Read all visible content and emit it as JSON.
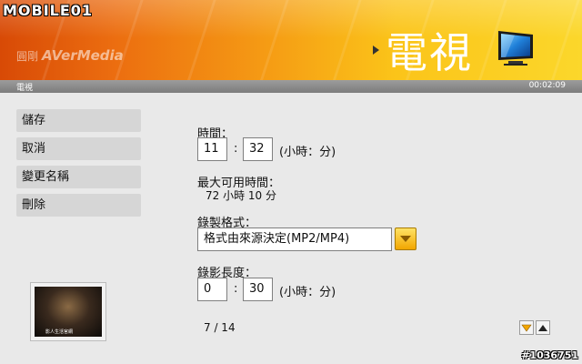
{
  "header": {
    "watermark": "MOBILE01",
    "brand_zh": "圓剛",
    "brand_en": "AVerMedia",
    "title": "電視"
  },
  "statusbar": {
    "left_label": "電視",
    "time": "00:02:09"
  },
  "sidebar": {
    "items": [
      {
        "label": "儲存"
      },
      {
        "label": "取消"
      },
      {
        "label": "變更名稱"
      },
      {
        "label": "刪除"
      }
    ]
  },
  "form": {
    "time_label": "時間：",
    "hour_value": "11",
    "minute_value": "32",
    "colon": ":",
    "time_unit": "(小時：分)",
    "max_time_label": "最大可用時間：",
    "max_time_value": "72 小時 10 分",
    "format_label": "錄製格式：",
    "format_value": "格式由來源決定(MP2/MP4)",
    "length_label": "錄影長度：",
    "length_hour_value": "0",
    "length_minute_value": "30",
    "length_unit": "(小時：分)"
  },
  "pager": {
    "text": "7 / 14"
  },
  "thumbnail": {
    "caption": "影人生活官網"
  },
  "footer_watermark": "#1036751",
  "colors": {
    "header_start": "#d84a06",
    "header_end": "#fbd72b",
    "dropdown_button": "#f5b400"
  }
}
